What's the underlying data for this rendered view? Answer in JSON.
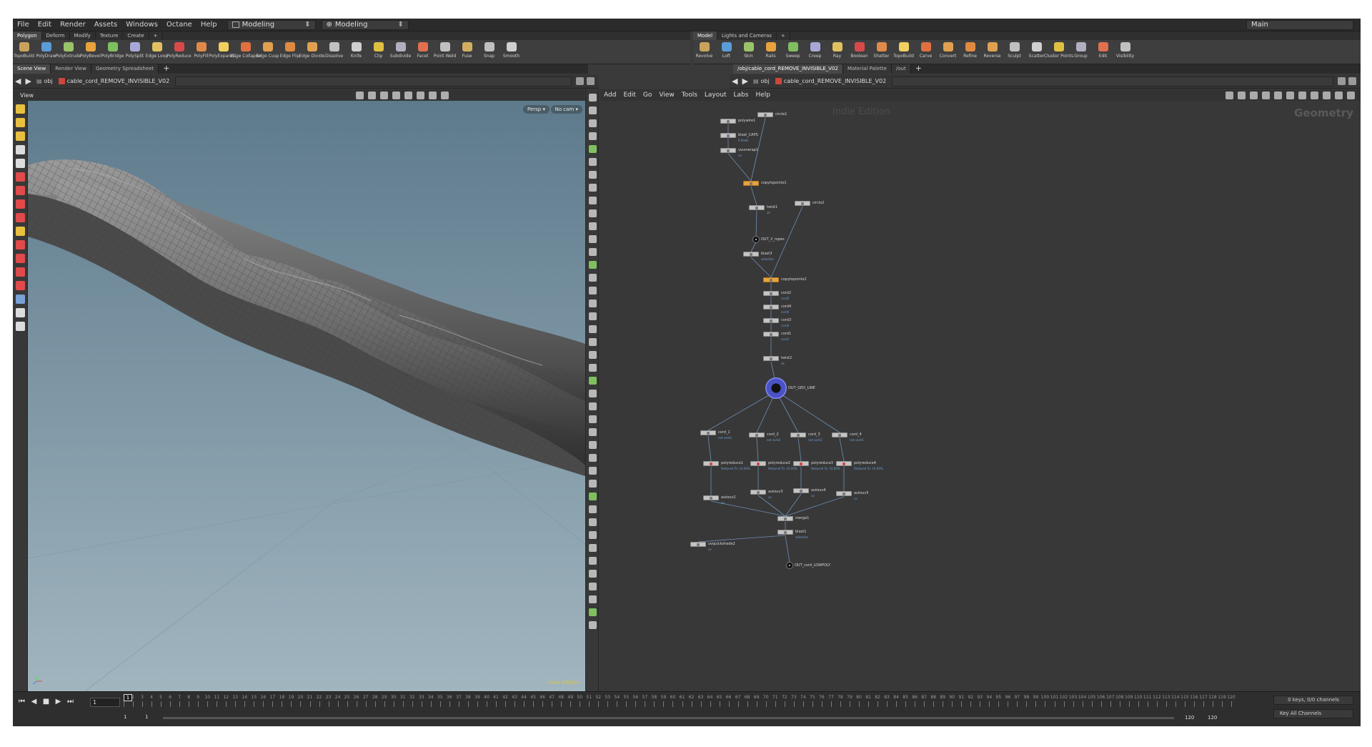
{
  "menu": [
    "File",
    "Edit",
    "Render",
    "Assets",
    "Windows",
    "Octane",
    "Help"
  ],
  "desktops": [
    "Modeling",
    "Modeling"
  ],
  "desktop_right": "Main",
  "shelf_left": {
    "tabs": [
      "Polygon",
      "Deform",
      "Modify",
      "Texture",
      "Create"
    ],
    "tools": [
      "TopoBuild",
      "PolyDraw",
      "PolyExtrude",
      "PolyBevel",
      "PolyBridge",
      "PolySplit",
      "Edge Loop",
      "PolyReduce",
      "PolyFill",
      "PolyExpand...",
      "Edge Collapse",
      "Edge Cusp",
      "Edge Flip",
      "Edge Divide",
      "Dissolve",
      "Knife",
      "Clip",
      "Subdivide",
      "Facet",
      "Point Weld",
      "Fuse",
      "Snap",
      "Smooth"
    ]
  },
  "shelf_right": {
    "tabs": [
      "Model",
      "Lights and Cameras"
    ],
    "tools": [
      "Revolve",
      "Loft",
      "Skin",
      "Rails",
      "Sweep",
      "Creep",
      "Ray",
      "Boolean",
      "Shatter",
      "TopoBuild",
      "Carve",
      "Convert",
      "Refine",
      "Reverse",
      "Sculpt",
      "Scatter",
      "Cluster Points",
      "Group",
      "Edit",
      "Visibility"
    ]
  },
  "left_pane": {
    "tabs": [
      "Scene View",
      "Render View",
      "Geometry Spreadsheet"
    ],
    "path": [
      "obj",
      "cable_cord_REMOVE_INVISIBLE_V02"
    ],
    "view_title": "View",
    "persp": "Persp ▾",
    "cam": "No cam ▾",
    "indie": "Indie Edition"
  },
  "right_pane": {
    "tabs": [
      "/obj/cable_cord_REMOVE_INVISIBLE_V02",
      "Material Palette",
      "/out"
    ],
    "path": [
      "obj",
      "cable_cord_REMOVE_INVISIBLE_V02"
    ],
    "menu": [
      "Add",
      "Edit",
      "Go",
      "View",
      "Tools",
      "Layout",
      "Labs",
      "Help"
    ],
    "indie": "Indie Edition",
    "context": "Geometry"
  },
  "nodes": [
    {
      "id": "polywire1",
      "label": "polywire1",
      "sub": ""
    },
    {
      "id": "circle1",
      "label": "circle1",
      "sub": ""
    },
    {
      "id": "blast_caps",
      "label": "blast_CAPS",
      "sub": "0 fields"
    },
    {
      "id": "uvunwrap1",
      "label": "uvunwrap1",
      "sub": "uv"
    },
    {
      "id": "copytopoints1",
      "label": "copytopoints1",
      "sub": ""
    },
    {
      "id": "circle2",
      "label": "circle2",
      "sub": ""
    },
    {
      "id": "twist1",
      "label": "twist1",
      "sub": "ok"
    },
    {
      "id": "out2",
      "label": "OUT_2_ropes",
      "sub": ""
    },
    {
      "id": "blast3",
      "label": "blast3",
      "sub": "selection"
    },
    {
      "id": "copytopoints2",
      "label": "copytopoints2",
      "sub": ""
    },
    {
      "id": "cord2",
      "label": "cord2",
      "sub": "cord2"
    },
    {
      "id": "cord4",
      "label": "cord4",
      "sub": "cord4"
    },
    {
      "id": "cord3",
      "label": "cord3",
      "sub": "cord3"
    },
    {
      "id": "cord1",
      "label": "cord1",
      "sub": "cord1"
    },
    {
      "id": "twist2",
      "label": "twist2",
      "sub": "ok"
    },
    {
      "id": "geo_line",
      "label": "OUT_GEO_LINE",
      "sub": ""
    },
    {
      "id": "cord_1",
      "label": "cord_1",
      "sub": "not cord1"
    },
    {
      "id": "cord_2",
      "label": "cord_2",
      "sub": "not cord2"
    },
    {
      "id": "cord_3",
      "label": "cord_3",
      "sub": "not cord3"
    },
    {
      "id": "cord_4",
      "label": "cord_4",
      "sub": "not cord4"
    },
    {
      "id": "pr1",
      "label": "polyreduce1",
      "sub": "Reduced To: 10.00%"
    },
    {
      "id": "pr2",
      "label": "polyreduce2",
      "sub": "Reduced To: 10.00%"
    },
    {
      "id": "pr3",
      "label": "polyreduce3",
      "sub": "Reduced To: 10.00%"
    },
    {
      "id": "pr4",
      "label": "polyreduce4",
      "sub": "Reduced To: 10.00%"
    },
    {
      "id": "au3",
      "label": "autouv3",
      "sub": "uv"
    },
    {
      "id": "au4",
      "label": "autouv4",
      "sub": "uv"
    },
    {
      "id": "au5",
      "label": "autouv5",
      "sub": "uv"
    },
    {
      "id": "au2",
      "label": "autouv2",
      "sub": "uv"
    },
    {
      "id": "merge1",
      "label": "merge1",
      "sub": ""
    },
    {
      "id": "blast1",
      "label": "blast1",
      "sub": "selection"
    },
    {
      "id": "uvqs2",
      "label": "uvquickshade2",
      "sub": "uv"
    },
    {
      "id": "out_low",
      "label": "OUT_cord_LOWPOLY",
      "sub": ""
    }
  ],
  "timeline": {
    "current_frame": "1",
    "cursor": "1",
    "start": "1",
    "end": "120",
    "range_start": "1",
    "range_start2": "1",
    "range_end": "120",
    "range_end2": "120",
    "keys": "0 keys, 0/0 channels",
    "channels": "Key All Channels"
  },
  "colors": {
    "accent": "#e8a33c",
    "display_ring": "#5a62d8",
    "ui_bg": "#3a3a3a",
    "link": "#6f9fd2"
  }
}
